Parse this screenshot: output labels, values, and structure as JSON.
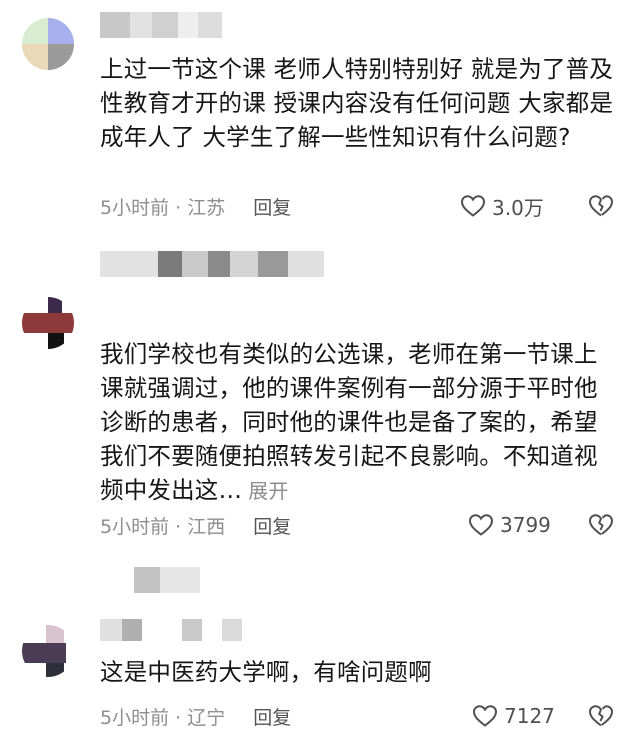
{
  "comments": [
    {
      "text": "上过一节这个课 老师人特别特别好 就是为了普及性教育才开的课 授课内容没有任何问题 大家都是成年人了 大学生了解一些性知识有什么问题?",
      "time_location": "5小时前 · 江苏",
      "reply_label": "回复",
      "likes": "3.0万",
      "expand_label": "",
      "avatar_colors": [
        "#d8ecd0",
        "#a7b0ec",
        "#ead9b8",
        "#9b9b9b"
      ],
      "username_colors": [
        "#c8c8c8",
        "#e2e2e2",
        "#d0d0d0",
        "#eeeeee",
        "#dcdcdc"
      ]
    },
    {
      "text": "我们学校也有类似的公选课，老师在第一节课上课就强调过，他的课件案例有一部分源于平时他诊断的患者，同时他的课件也是备了案的，希望我们不要随便拍照转发引起不良影响。不知道视频中发出这…",
      "time_location": "5小时前 · 江西",
      "reply_label": "回复",
      "likes": "3799",
      "expand_label": "展开",
      "avatar_colors": [
        "#8e3a3a",
        "#3b2a4a",
        "#b38f8f",
        "#111111"
      ],
      "username_colors": [
        "#b5b5b5",
        "#7a7a7a",
        "#c9c9c9",
        "#8a8a8a",
        "#d4d4d4",
        "#9a9a9a",
        "#e0e0e0"
      ]
    },
    {
      "text": "这是中医药大学啊，有啥问题啊",
      "time_location": "5小时前 · 辽宁",
      "reply_label": "回复",
      "likes": "7127",
      "expand_label": "",
      "avatar_colors": [
        "#d9c3cf",
        "#4b3c55",
        "#2f2f3a",
        "#8c7b8a"
      ],
      "username_colors": [
        "#c2c2c2",
        "#e6e6e6",
        "#b0b0b0",
        "#dadada"
      ]
    }
  ]
}
